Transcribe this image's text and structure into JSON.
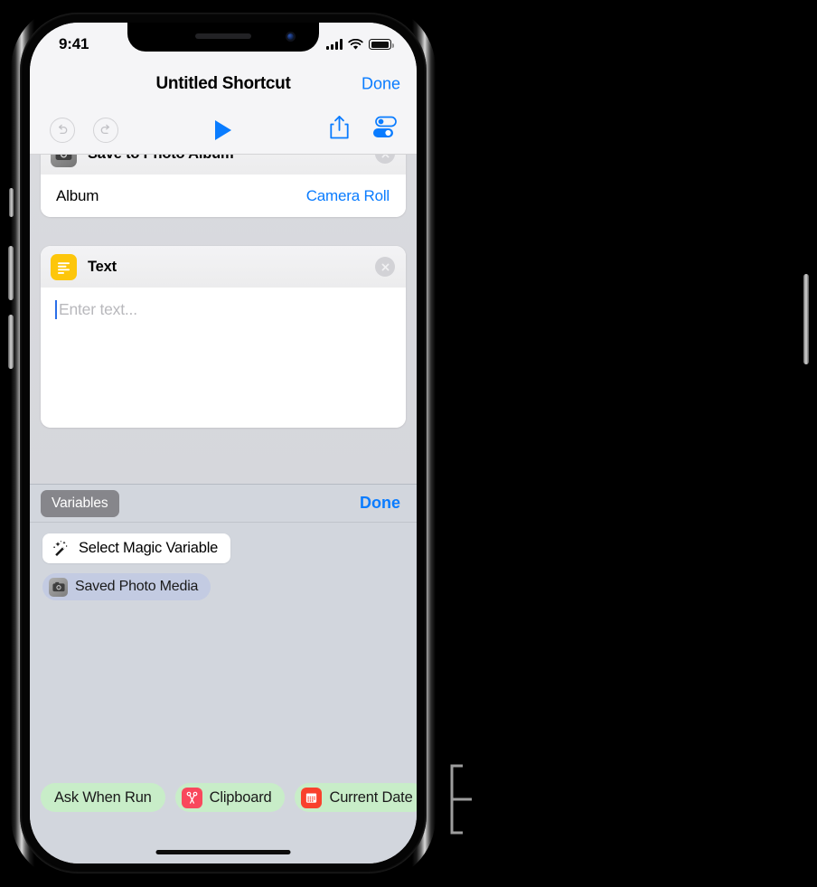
{
  "status_bar": {
    "time": "9:41",
    "cellular_icon": "cellular-signal-icon",
    "wifi_icon": "wifi-icon",
    "battery_icon": "battery-icon"
  },
  "nav_bar": {
    "title": "Untitled Shortcut",
    "done_label": "Done"
  },
  "toolbar": {
    "undo_icon": "undo-icon",
    "redo_icon": "redo-icon",
    "play_icon": "play-icon",
    "share_icon": "share-icon",
    "settings_icon": "settings-toggles-icon"
  },
  "actions": [
    {
      "icon": "camera-icon",
      "title": "Save to Photo Album",
      "close_icon": "close-icon",
      "param_label": "Album",
      "param_value": "Camera Roll"
    },
    {
      "icon": "text-lines-icon",
      "title": "Text",
      "close_icon": "close-icon",
      "placeholder": "Enter text..."
    }
  ],
  "variables_panel": {
    "variables_button": "Variables",
    "done_label": "Done",
    "magic_variable": {
      "icon": "magic-wand-icon",
      "label": "Select Magic Variable"
    },
    "saved_media": {
      "icon": "camera-icon",
      "label": "Saved Photo Media"
    },
    "chips": [
      {
        "label": "Ask When Run",
        "icon": null
      },
      {
        "label": "Clipboard",
        "icon": "scissors-icon"
      },
      {
        "label": "Current Date",
        "icon": "calendar-icon"
      }
    ]
  },
  "colors": {
    "accent_blue": "#0a7cff",
    "panel_background": "#d2d6dd",
    "chip_green": "#c8edc8",
    "chip_blue": "#c3cbe2",
    "text_icon_yellow": "#fdc60b",
    "clipboard_red": "#f9485c",
    "calendar_red": "#f9412c"
  }
}
